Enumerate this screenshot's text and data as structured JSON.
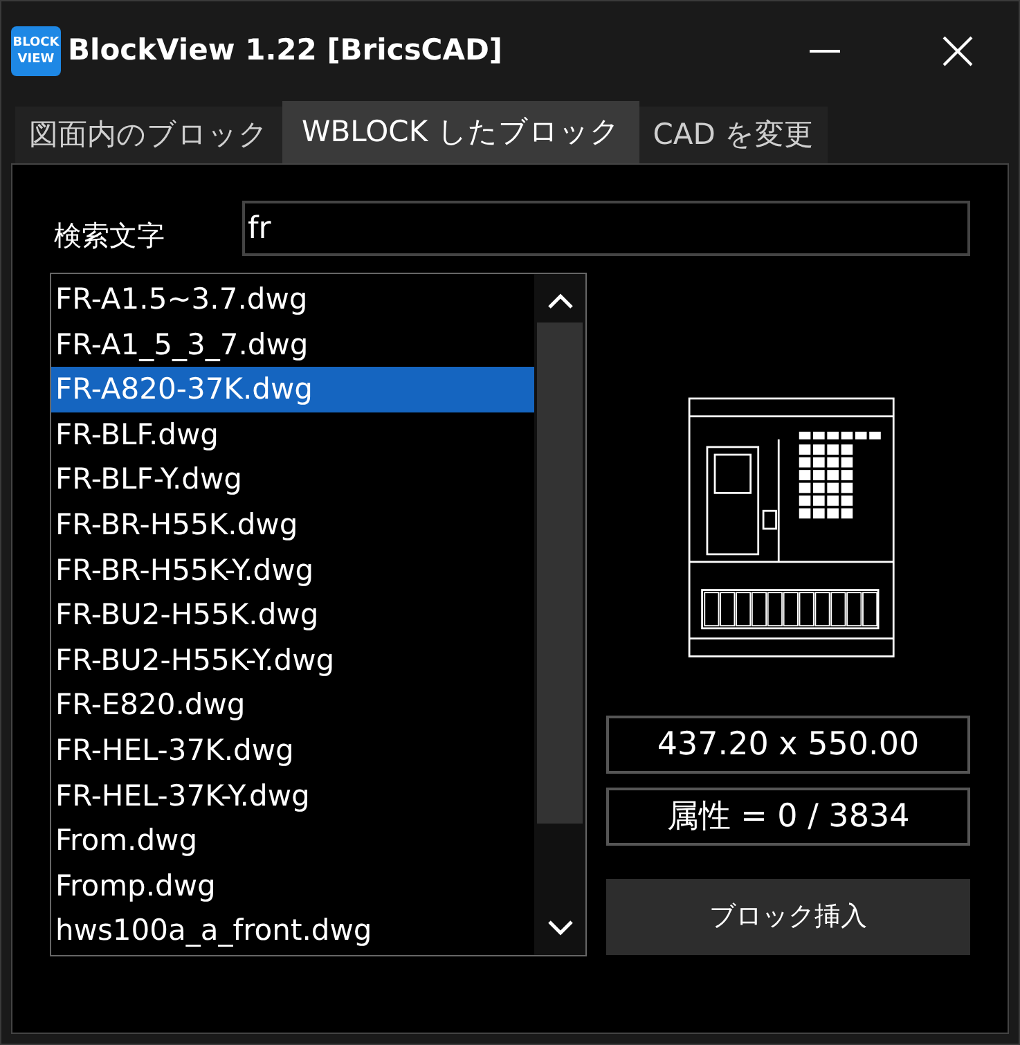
{
  "window": {
    "title": "BlockView 1.22 [BricsCAD]",
    "app_icon": [
      "BLOCK",
      "VIEW"
    ]
  },
  "tabs": [
    {
      "label": "図面内のブロック",
      "selected": false
    },
    {
      "label": "WBLOCK したブロック",
      "selected": true
    },
    {
      "label": "CAD を変更",
      "selected": false
    }
  ],
  "search": {
    "label": "検索文字",
    "value": "fr"
  },
  "files": [
    {
      "name": "FR-A1.5~3.7.dwg",
      "selected": false
    },
    {
      "name": "FR-A1_5_3_7.dwg",
      "selected": false
    },
    {
      "name": "FR-A820-37K.dwg",
      "selected": true
    },
    {
      "name": "FR-BLF.dwg",
      "selected": false
    },
    {
      "name": "FR-BLF-Y.dwg",
      "selected": false
    },
    {
      "name": "FR-BR-H55K.dwg",
      "selected": false
    },
    {
      "name": "FR-BR-H55K-Y.dwg",
      "selected": false
    },
    {
      "name": "FR-BU2-H55K.dwg",
      "selected": false
    },
    {
      "name": "FR-BU2-H55K-Y.dwg",
      "selected": false
    },
    {
      "name": "FR-E820.dwg",
      "selected": false
    },
    {
      "name": "FR-HEL-37K.dwg",
      "selected": false
    },
    {
      "name": "FR-HEL-37K-Y.dwg",
      "selected": false
    },
    {
      "name": "From.dwg",
      "selected": false
    },
    {
      "name": "Fromp.dwg",
      "selected": false
    },
    {
      "name": "hws100a_a_front.dwg",
      "selected": false
    }
  ],
  "dimensions": "437.20 x 550.00",
  "attributes": "属性 = 0 / 3834",
  "insert_button": "ブロック挿入"
}
